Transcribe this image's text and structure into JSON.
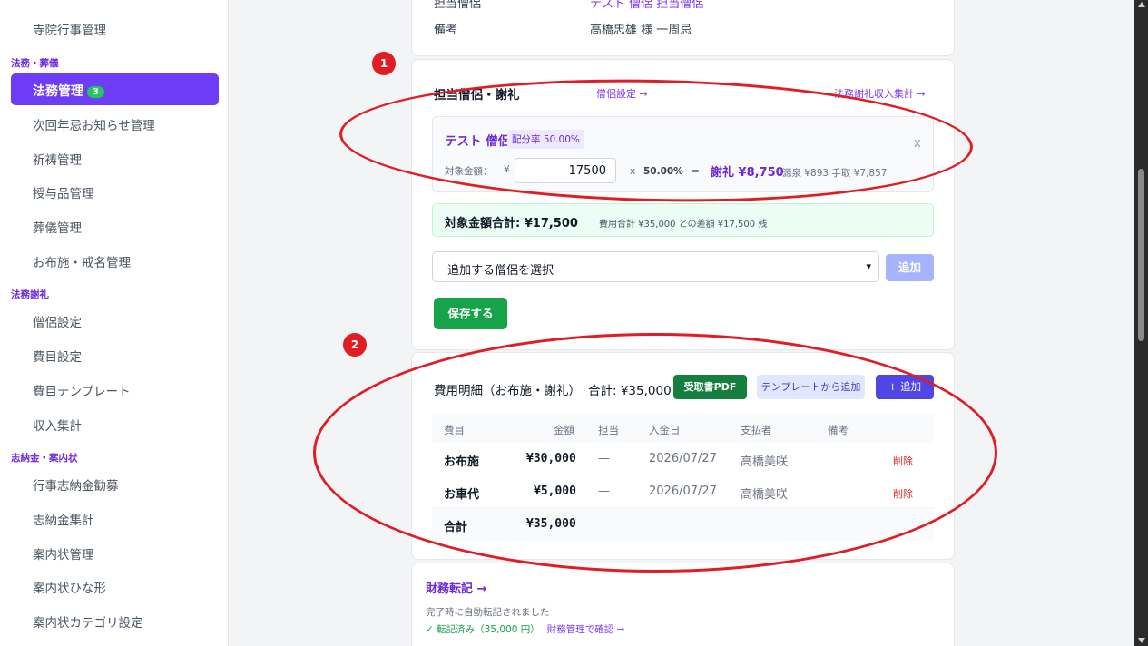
{
  "sidebar": {
    "top_item": "寺院行事管理",
    "section_houmu": "法務・葬儀",
    "active_item": "法務管理",
    "active_badge": "3",
    "items_houmu": [
      "次回年忌お知らせ管理",
      "祈祷管理",
      "授与品管理",
      "葬儀管理",
      "お布施・戒名管理"
    ],
    "section_shareiv": "法務謝礼",
    "items_sharei": [
      "僧侶設定",
      "費目設定",
      "費目テンプレート",
      "収入集計"
    ],
    "section_shinou": "志納金・案内状",
    "items_shinou": [
      "行事志納金勧募",
      "志納金集計",
      "案内状管理",
      "案内状ひな形",
      "案内状カテゴリ設定"
    ]
  },
  "detail": {
    "partial_label": "担当僧侶",
    "partial_value": "テスト 僧侶 担当僧侶",
    "remarks_label": "備考",
    "remarks_value": "高橋忠雄 様 一周忌"
  },
  "priest_card": {
    "title": "担当僧侶・謝礼",
    "settings_link": "僧侶設定 →",
    "income_link": "法務謝礼収入集計 →",
    "priest_name": "テスト 僧侶",
    "rate_badge": "配分率 50.00%",
    "close": "x",
    "target_label": "対象金額：",
    "yen_prefix": "¥",
    "target_value": "17500",
    "multiply": "x",
    "rate": "50.00%",
    "equals": "=",
    "reward": "謝礼 ¥8,750",
    "withholding": "源泉 ¥893 手取 ¥7,857",
    "total_label": "対象金額合計: ¥17,500",
    "total_note": "費用合計 ¥35,000 との差額 ¥17,500 残",
    "select_placeholder": "追加する僧侶を選択",
    "add_button": "追加",
    "save_button": "保存する"
  },
  "expense_card": {
    "title": "費用明細（お布施・謝礼）",
    "total": "合計: ¥35,000",
    "pdf_button": "受取書PDF",
    "template_button": "テンプレートから追加",
    "add_button": "+ 追加",
    "columns": [
      "費目",
      "金額",
      "担当",
      "入金日",
      "支払者",
      "備考"
    ],
    "rows": [
      {
        "item": "お布施",
        "amount": "¥30,000",
        "staff": "—",
        "date": "2026/07/27",
        "payer": "高橋美咲",
        "note": "",
        "action": "削除"
      },
      {
        "item": "お車代",
        "amount": "¥5,000",
        "staff": "—",
        "date": "2026/07/27",
        "payer": "高橋美咲",
        "note": "",
        "action": "削除"
      }
    ],
    "footer_label": "合計",
    "footer_amount": "¥35,000"
  },
  "finance": {
    "title": "財務転記 →",
    "subtitle": "完了時に自動転記されました",
    "status": "✓ 転記済み（35,000 円）",
    "link": "財務管理で確認 →"
  },
  "annotations": {
    "marker1": "1",
    "marker2": "2",
    "color": "#e11d24"
  },
  "colors": {
    "accent": "#6d3df5",
    "success": "#16a34a",
    "danger": "#dc2626"
  }
}
